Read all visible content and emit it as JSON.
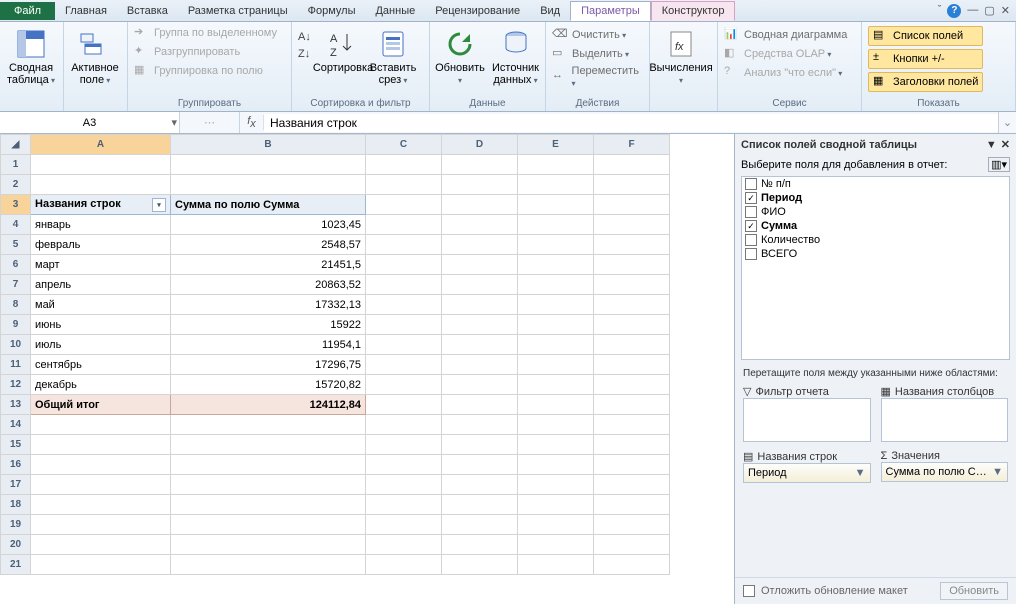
{
  "tabs": {
    "file": "Файл",
    "home": "Главная",
    "insert": "Вставка",
    "layout": "Разметка страницы",
    "formulas": "Формулы",
    "data": "Данные",
    "review": "Рецензирование",
    "view": "Вид",
    "options": "Параметры",
    "design": "Конструктор"
  },
  "ribbon": {
    "pivot": "Сводная таблица",
    "activefield": "Активное поле",
    "group": {
      "by_sel": "Группа по выделенному",
      "ungroup": "Разгруппировать",
      "by_field": "Группировка по полю",
      "label": "Группировать"
    },
    "sort": {
      "sort": "Сортировка",
      "label": "Сортировка и фильтр"
    },
    "insert_slicer": "Вставить срез",
    "data": {
      "refresh": "Обновить",
      "source": "Источник данных",
      "label": "Данные"
    },
    "actions": {
      "clear": "Очистить",
      "select": "Выделить",
      "move": "Переместить",
      "label": "Действия"
    },
    "calc": {
      "calc": "Вычисления"
    },
    "service": {
      "chart": "Сводная диаграмма",
      "olap": "Средства OLAP",
      "whatif": "Анализ \"что если\"",
      "label": "Сервис"
    },
    "show": {
      "fields": "Список полей",
      "buttons": "Кнопки +/-",
      "headers": "Заголовки полей",
      "label": "Показать"
    }
  },
  "namebox": "A3",
  "formula": "Названия строк",
  "columns": [
    "A",
    "B",
    "C",
    "D",
    "E",
    "F"
  ],
  "pivot_headers": {
    "rows": "Названия строк",
    "sum": "Сумма по полю Сумма"
  },
  "pivot_rows": [
    {
      "label": "январь",
      "value": "1023,45"
    },
    {
      "label": "февраль",
      "value": "2548,57"
    },
    {
      "label": "март",
      "value": "21451,5"
    },
    {
      "label": "апрель",
      "value": "20863,52"
    },
    {
      "label": "май",
      "value": "17332,13"
    },
    {
      "label": "июнь",
      "value": "15922"
    },
    {
      "label": "июль",
      "value": "11954,1"
    },
    {
      "label": "сентябрь",
      "value": "17296,75"
    },
    {
      "label": "декабрь",
      "value": "15720,82"
    }
  ],
  "grand": {
    "label": "Общий итог",
    "value": "124112,84"
  },
  "panel": {
    "title": "Список полей сводной таблицы",
    "choose": "Выберите поля для добавления в отчет:",
    "fields": [
      {
        "name": "№ п/п",
        "checked": false
      },
      {
        "name": "Период",
        "checked": true
      },
      {
        "name": "ФИО",
        "checked": false
      },
      {
        "name": "Сумма",
        "checked": true
      },
      {
        "name": "Количество",
        "checked": false
      },
      {
        "name": "ВСЕГО",
        "checked": false
      }
    ],
    "drag": "Перетащите поля между указанными ниже областями:",
    "area_filter": "Фильтр отчета",
    "area_cols": "Названия столбцов",
    "area_rows": "Названия строк",
    "area_vals": "Значения",
    "chip_rows": "Период",
    "chip_vals": "Сумма по полю С…",
    "defer": "Отложить обновление макет",
    "update": "Обновить"
  }
}
